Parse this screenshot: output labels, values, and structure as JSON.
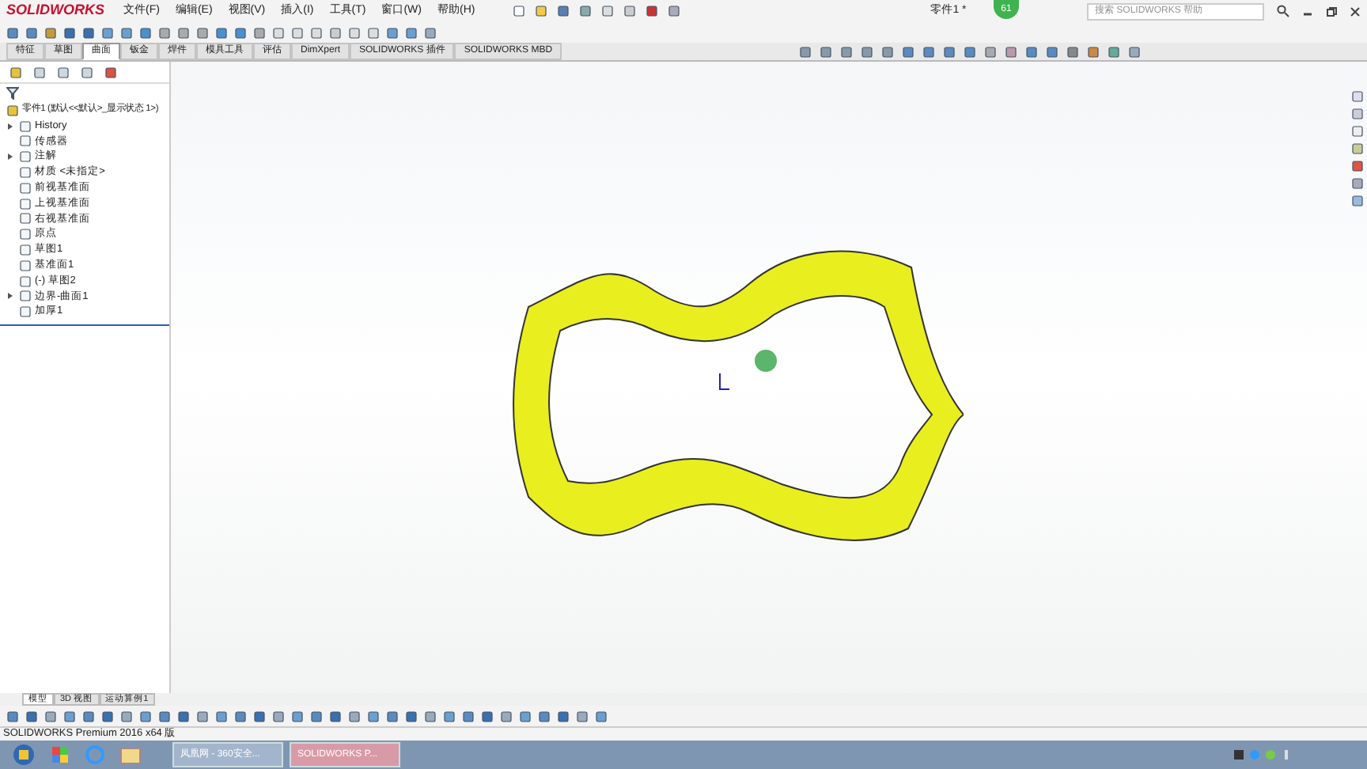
{
  "app": {
    "logo": "SOLIDWORKS",
    "menu": [
      "文件(F)",
      "编辑(E)",
      "视图(V)",
      "插入(I)",
      "工具(T)",
      "窗口(W)",
      "帮助(H)"
    ],
    "document_title": "零件1 *",
    "badge": "61",
    "search": {
      "placeholder": "搜索 SOLIDWORKS 帮助"
    }
  },
  "command_tabs": [
    {
      "label": "特征",
      "selected": false
    },
    {
      "label": "草图",
      "selected": false
    },
    {
      "label": "曲面",
      "selected": true
    },
    {
      "label": "钣金",
      "selected": false
    },
    {
      "label": "焊件",
      "selected": false
    },
    {
      "label": "模具工具",
      "selected": false
    },
    {
      "label": "评估",
      "selected": false
    },
    {
      "label": "DimXpert",
      "selected": false
    },
    {
      "label": "SOLIDWORKS 插件",
      "selected": false
    },
    {
      "label": "SOLIDWORKS MBD",
      "selected": false
    }
  ],
  "feature_tree": {
    "root": "零件1  (默认<<默认>_显示状态 1>)",
    "items": [
      {
        "label": "History",
        "expanded": false
      },
      {
        "label": "传感器"
      },
      {
        "label": "注解",
        "expanded": false
      },
      {
        "label": "材质 <未指定>"
      },
      {
        "label": "前视基准面"
      },
      {
        "label": "上视基准面"
      },
      {
        "label": "右视基准面"
      },
      {
        "label": "原点"
      },
      {
        "label": "草图1"
      },
      {
        "label": "基准面1"
      },
      {
        "label": "(-) 草图2"
      },
      {
        "label": "边界-曲面1",
        "expanded": false
      },
      {
        "label": "加厚1"
      }
    ]
  },
  "bottom_tabs": [
    {
      "label": "模型",
      "selected": true
    },
    {
      "label": "3D 视图",
      "selected": false
    },
    {
      "label": "运动算例1",
      "selected": false
    }
  ],
  "status_bar": "SOLIDWORKS Premium 2016 x64 版",
  "taskbar": [
    {
      "label": "凤凰网 - 360安全...",
      "selected": false
    },
    {
      "label": "SOLIDWORKS P...",
      "selected": true
    }
  ]
}
